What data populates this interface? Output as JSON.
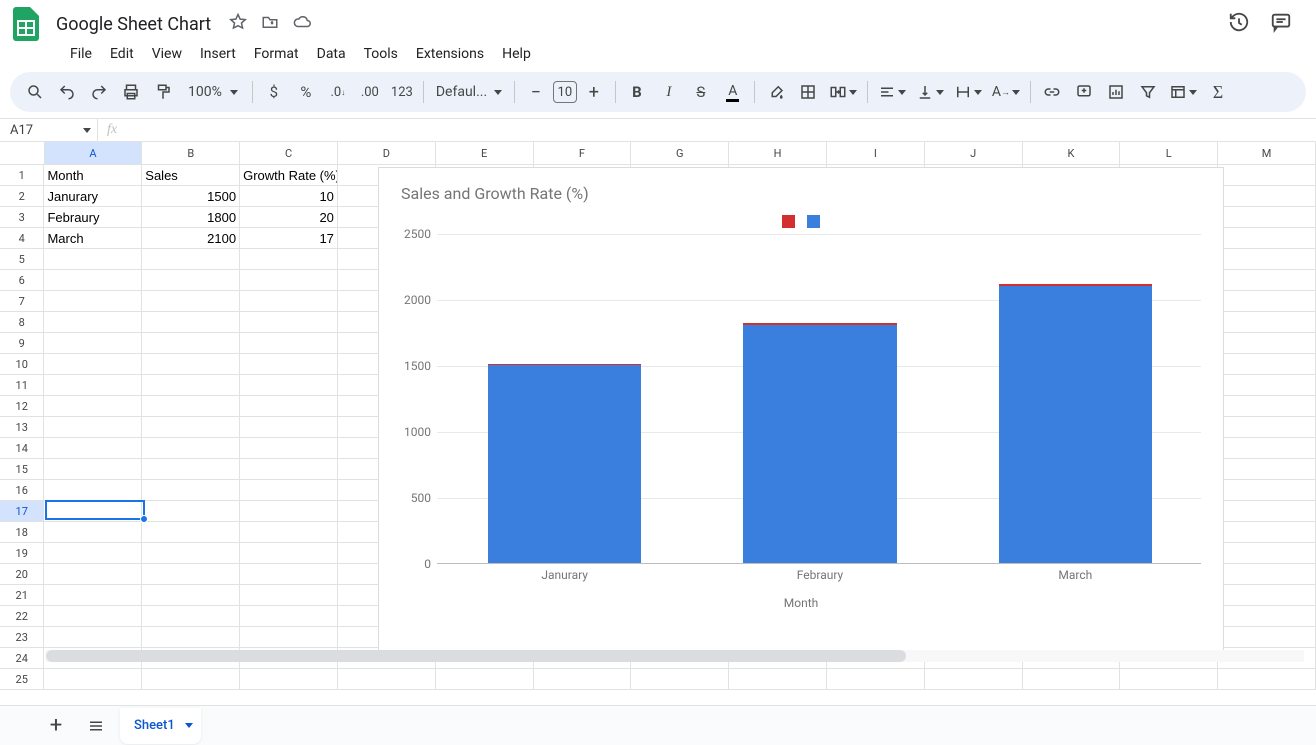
{
  "doc_title": "Google Sheet Chart",
  "menu": [
    "File",
    "Edit",
    "View",
    "Insert",
    "Format",
    "Data",
    "Tools",
    "Extensions",
    "Help"
  ],
  "toolbar": {
    "zoom": "100%",
    "font": "Defaul...",
    "font_size": "10",
    "currency_glyph": "$",
    "percent_glyph": "%",
    "number_format": "123"
  },
  "name_box": "A17",
  "fx_label": "fx",
  "columns": [
    "A",
    "B",
    "C",
    "D",
    "E",
    "F",
    "G",
    "H",
    "I",
    "J",
    "K",
    "L",
    "M"
  ],
  "selected": {
    "col": 0,
    "row": 17
  },
  "grid_rows": 25,
  "table": {
    "headers": [
      "Month",
      "Sales",
      "Growth Rate (%)"
    ],
    "rows": [
      {
        "month": "Janurary",
        "sales": 1500,
        "growth": 10
      },
      {
        "month": "Febraury",
        "sales": 1800,
        "growth": 20
      },
      {
        "month": "March",
        "sales": 2100,
        "growth": 17
      }
    ]
  },
  "chart_data": {
    "type": "bar",
    "title": "Sales and Growth Rate (%)",
    "xlabel": "Month",
    "ylabel": "",
    "ylim": [
      0,
      2500
    ],
    "categories": [
      "Janurary",
      "Febraury",
      "March"
    ],
    "series": [
      {
        "name": "Growth Rate (%)",
        "color": "#d32f2f",
        "values": [
          10,
          20,
          17
        ]
      },
      {
        "name": "Sales",
        "color": "#3a7ede",
        "values": [
          1500,
          1800,
          2100
        ]
      }
    ],
    "y_ticks": [
      0,
      500,
      1000,
      1500,
      2000,
      2500
    ]
  },
  "sheet_tab": "Sheet1"
}
